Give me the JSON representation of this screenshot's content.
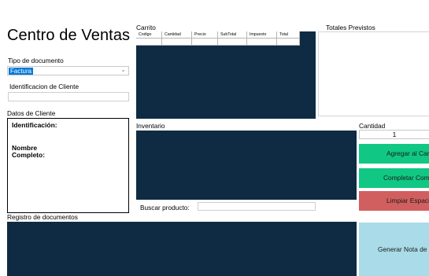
{
  "app": {
    "title": "Centro de Ventas"
  },
  "document": {
    "type_label": "Tipo de documento",
    "type_selected": "Factura",
    "client_id_label": "Identificacion de Cliente"
  },
  "client": {
    "section_label": "Datos de Cliente",
    "id_label": "Identificación:",
    "name_label_line1": "Nombre",
    "name_label_line2": "Completo:"
  },
  "cart": {
    "label": "Carrito",
    "columns": [
      "Codigo",
      "Cantidad",
      "Precio",
      "SubTotal",
      "Impuesto",
      "Total"
    ]
  },
  "totals": {
    "label": "Totales Previstos"
  },
  "inventory": {
    "label": "Inventario",
    "search_label": "Buscar producto:"
  },
  "quantity": {
    "label": "Cantidad",
    "value": "1"
  },
  "buttons": {
    "add": "Agregar al Carrito",
    "complete": "Completar Compra",
    "clear": "Limpiar Espacios",
    "generate_note": "Generar Nota de crédito"
  },
  "records": {
    "label": "Registro de documentos"
  },
  "colors": {
    "dark_panel": "#0f2b44",
    "green_button": "#10c884",
    "red_button": "#d25f5f",
    "blue_button": "#a9dbe8",
    "selection": "#0078d7"
  },
  "icons": {
    "dropdown": "chevron-down-icon"
  }
}
